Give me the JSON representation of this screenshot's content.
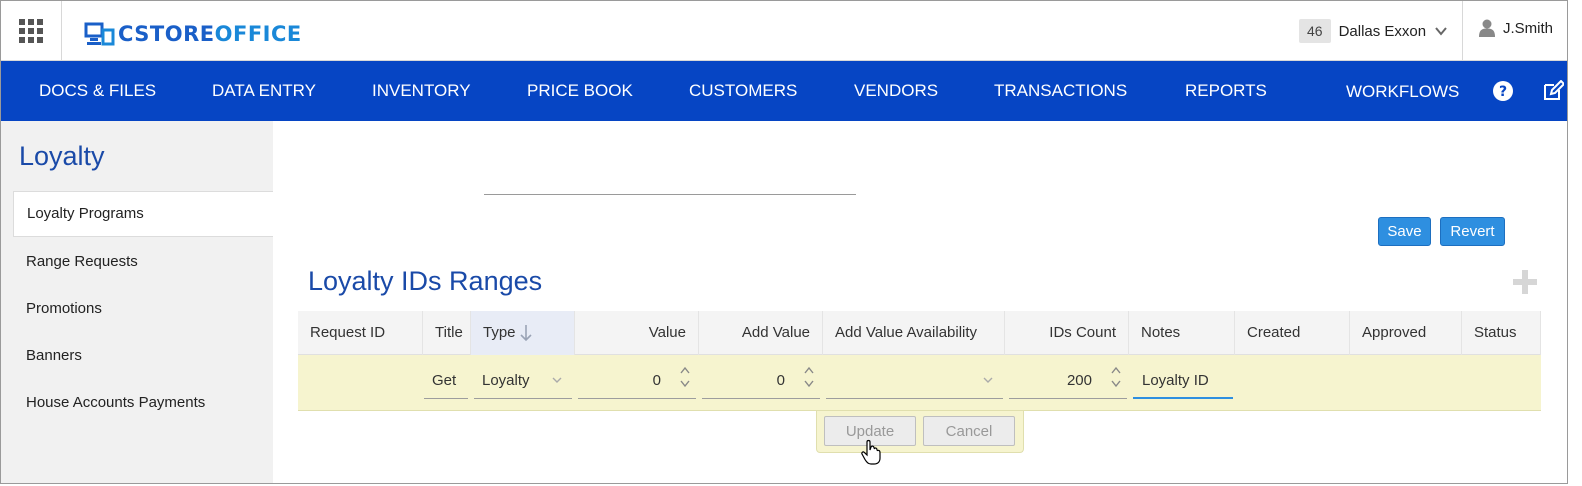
{
  "header": {
    "logo_text_left": "CSTORE",
    "logo_text_right": "OFFICE",
    "store_number": "46",
    "store_name": "Dallas Exxon",
    "user_name": "J.Smith"
  },
  "nav": {
    "items": [
      "DOCS & FILES",
      "DATA ENTRY",
      "INVENTORY",
      "PRICE BOOK",
      "CUSTOMERS",
      "VENDORS",
      "TRANSACTIONS",
      "REPORTS",
      "WORKFLOWS"
    ],
    "icons": [
      "help-icon",
      "edit-icon"
    ]
  },
  "sidebar": {
    "title": "Loyalty",
    "items": [
      {
        "label": "Loyalty Programs",
        "active": true
      },
      {
        "label": "Range Requests",
        "active": false
      },
      {
        "label": "Promotions",
        "active": false
      },
      {
        "label": "Banners",
        "active": false
      },
      {
        "label": "House Accounts Payments",
        "active": false
      }
    ]
  },
  "main": {
    "save_label": "Save",
    "revert_label": "Revert",
    "section_title": "Loyalty IDs Ranges",
    "columns": [
      "Request ID",
      "Title",
      "Type",
      "Value",
      "Add Value",
      "Add Value Availability",
      "IDs Count",
      "Notes",
      "Created",
      "Approved",
      "Status"
    ],
    "edit_row": {
      "title": "Get",
      "type": "Loyalty",
      "value": "0",
      "add_value": "0",
      "add_value_availability": "",
      "ids_count": "200",
      "notes": "Loyalty ID"
    },
    "update_label": "Update",
    "cancel_label": "Cancel"
  },
  "colors": {
    "nav_bg": "#0645c4",
    "accent": "#2e8fe0",
    "title": "#1a4aa8",
    "edit_row_bg": "#f6f4cf"
  }
}
